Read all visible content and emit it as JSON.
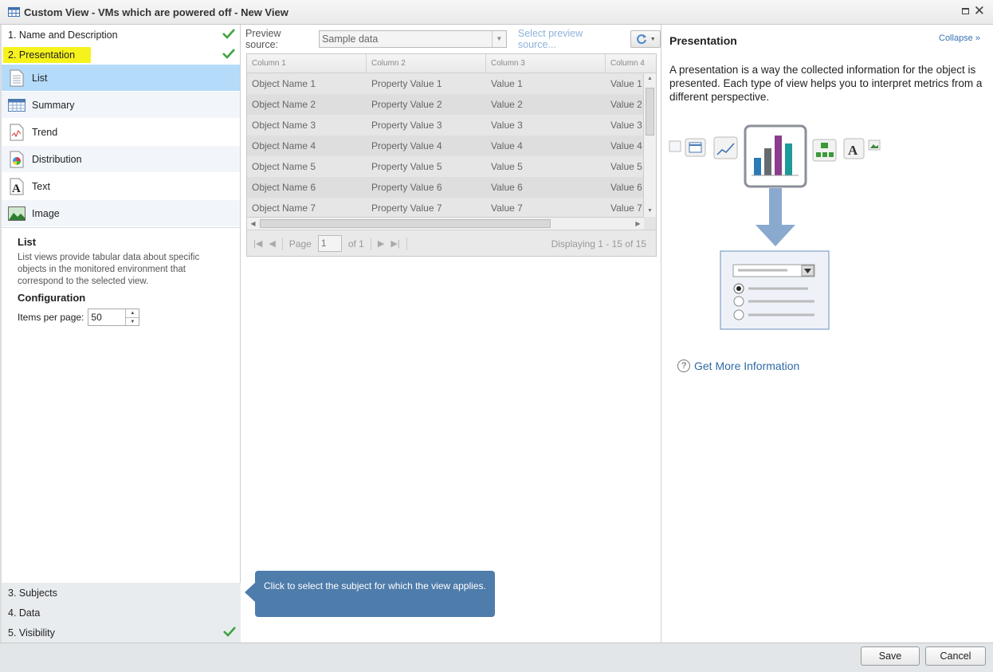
{
  "window": {
    "title": "Custom View - VMs which are powered off - New View"
  },
  "steps_top": [
    {
      "label": "1. Name and Description",
      "done": true
    },
    {
      "label": "2. Presentation",
      "done": true
    }
  ],
  "presentations": [
    {
      "label": "List",
      "icon": "list-icon",
      "selected": true
    },
    {
      "label": "Summary",
      "icon": "summary-table-icon",
      "selected": false
    },
    {
      "label": "Trend",
      "icon": "trend-icon",
      "selected": false
    },
    {
      "label": "Distribution",
      "icon": "distribution-pie-icon",
      "selected": false
    },
    {
      "label": "Text",
      "icon": "text-icon",
      "selected": false
    },
    {
      "label": "Image",
      "icon": "image-icon",
      "selected": false
    }
  ],
  "description": {
    "title": "List",
    "text": "List views provide tabular data about specific objects in the monitored environment that correspond to the selected view.",
    "config_title": "Configuration",
    "items_per_page_label": "Items per page:",
    "items_per_page_value": "50"
  },
  "steps_bottom": [
    {
      "label": "3. Subjects",
      "done": false
    },
    {
      "label": "4. Data",
      "done": false
    },
    {
      "label": "5. Visibility",
      "done": true
    }
  ],
  "preview": {
    "source_label": "Preview source:",
    "source_value": "Sample data",
    "select_link": "Select preview source..."
  },
  "grid": {
    "columns": [
      "Column 1",
      "Column 2",
      "Column 3",
      "Column 4"
    ],
    "rows": [
      [
        "Object Name 1",
        "Property Value 1",
        "Value 1",
        "Value 1"
      ],
      [
        "Object Name 2",
        "Property Value 2",
        "Value 2",
        "Value 2"
      ],
      [
        "Object Name 3",
        "Property Value 3",
        "Value 3",
        "Value 3"
      ],
      [
        "Object Name 4",
        "Property Value 4",
        "Value 4",
        "Value 4"
      ],
      [
        "Object Name 5",
        "Property Value 5",
        "Value 5",
        "Value 5"
      ],
      [
        "Object Name 6",
        "Property Value 6",
        "Value 6",
        "Value 6"
      ],
      [
        "Object Name 7",
        "Property Value 7",
        "Value 7",
        "Value 7"
      ]
    ]
  },
  "pager": {
    "page_label": "Page",
    "page_value": "1",
    "of_label": "of 1",
    "display_text": "Displaying 1 - 15 of 15"
  },
  "tooltip": {
    "text": "Click to select the subject for which the view applies."
  },
  "help": {
    "title": "Presentation",
    "collapse_label": "Collapse",
    "text": "A presentation is a way the collected information for the object is presented. Each type of view helps you to interpret metrics from a different perspective.",
    "more_link": "Get More Information"
  },
  "footer": {
    "save_label": "Save",
    "cancel_label": "Cancel"
  },
  "colors": {
    "selected_row": "#b5dbfa",
    "highlight": "#f6f21c",
    "tooltip_bg": "#4e7cab",
    "link": "#2f6aa6",
    "check": "#3fa33f"
  }
}
